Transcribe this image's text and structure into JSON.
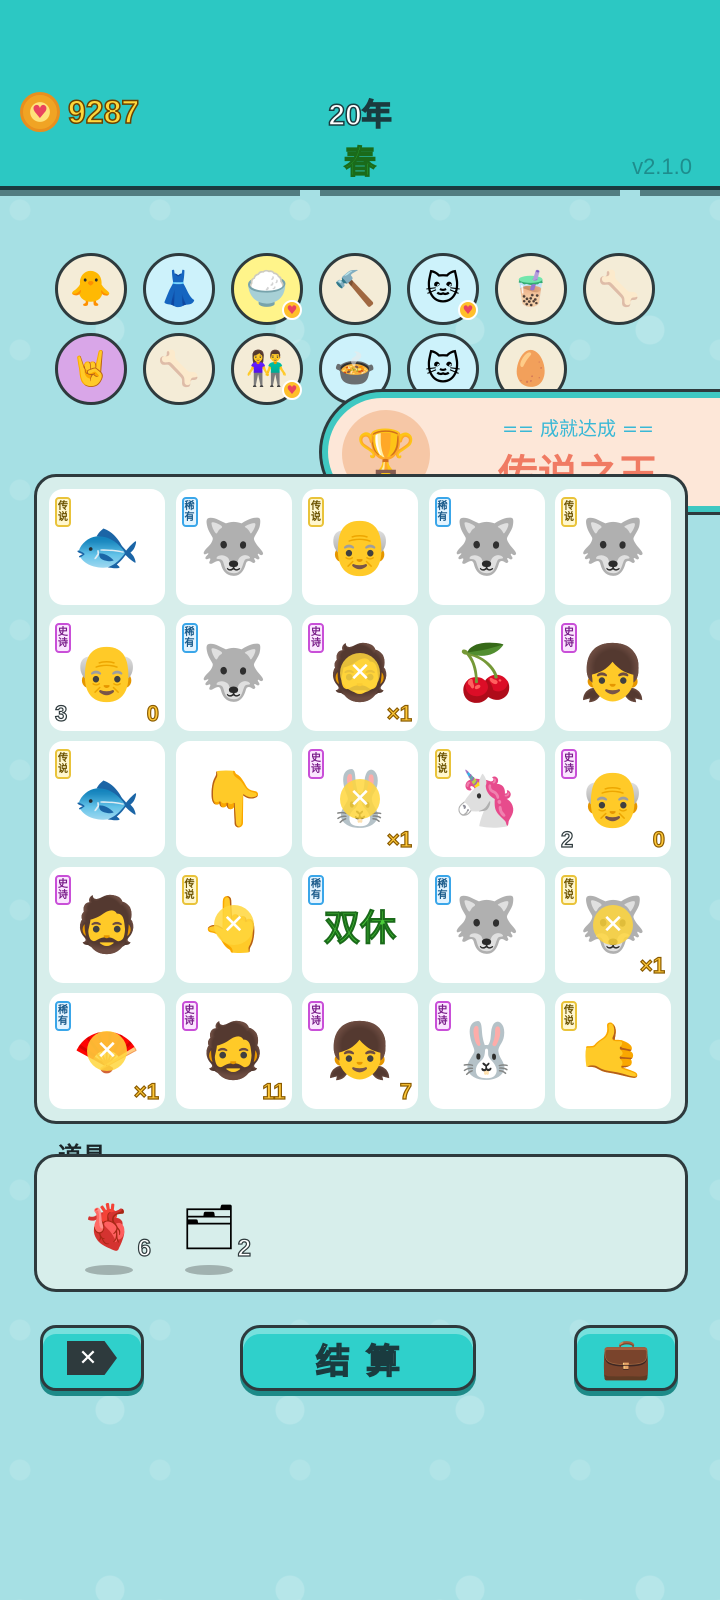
{
  "header": {
    "coins": "9287",
    "year": "20年",
    "season": "春",
    "version": "v2.1.0"
  },
  "collected": [
    {
      "icon": "chick-egg-icon",
      "glyph": "🐥"
    },
    {
      "icon": "skirt-icon",
      "glyph": "👗"
    },
    {
      "icon": "rice-bowl-icon",
      "glyph": "🍚"
    },
    {
      "icon": "hammer-icon",
      "glyph": "🔨"
    },
    {
      "icon": "cat-food-icon",
      "glyph": "🐱"
    },
    {
      "icon": "bubble-tea-icon",
      "glyph": "🧋"
    },
    {
      "icon": "dog-bowl-icon",
      "glyph": "🦴"
    },
    {
      "icon": "rock-hand-icon",
      "glyph": "🤘"
    },
    {
      "icon": "dog-bowl-icon",
      "glyph": "🦴"
    },
    {
      "icon": "couple-icon",
      "glyph": "👫"
    },
    {
      "icon": "cooking-pot-icon",
      "glyph": "🍲"
    },
    {
      "icon": "cat-food-icon",
      "glyph": "🐱"
    },
    {
      "icon": "egg-tray-icon",
      "glyph": "🥚"
    }
  ],
  "achievement": {
    "subtitle": "== 成就达成 ==",
    "title": "传说之王",
    "icon": "trophy-icon"
  },
  "rarity_labels": {
    "legend": "传说",
    "rare": "稀有",
    "epic": "史诗"
  },
  "board": [
    {
      "icon": "koi-fish-icon",
      "glyph": "🐟",
      "rarity": "legend"
    },
    {
      "icon": "husky-icon",
      "glyph": "🐺",
      "rarity": "rare"
    },
    {
      "icon": "grandpa-glasses-icon",
      "glyph": "👴",
      "rarity": "legend"
    },
    {
      "icon": "husky-icon",
      "glyph": "🐺",
      "rarity": "rare"
    },
    {
      "icon": "husky-crown-icon",
      "glyph": "🐺",
      "rarity": "legend"
    },
    {
      "icon": "old-man-icon",
      "glyph": "👴",
      "rarity": "epic",
      "left": "3",
      "right": "0"
    },
    {
      "icon": "husky-icon",
      "glyph": "🐺",
      "rarity": "rare"
    },
    {
      "icon": "green-hair-man-icon",
      "glyph": "🧔",
      "rarity": "epic",
      "right": "×1",
      "crossed": true
    },
    {
      "icon": "cherry-icon",
      "glyph": "🍒"
    },
    {
      "icon": "girl-hearts-icon",
      "glyph": "👧",
      "rarity": "epic"
    },
    {
      "icon": "koi-fish-icon",
      "glyph": "🐟",
      "rarity": "legend"
    },
    {
      "icon": "pointing-hand-icon",
      "glyph": "👇"
    },
    {
      "icon": "rabbit-tent-icon",
      "glyph": "🐰",
      "rarity": "epic",
      "right": "×1",
      "crossed": true
    },
    {
      "icon": "unicorn-icon",
      "glyph": "🦄",
      "rarity": "legend"
    },
    {
      "icon": "old-man-icon",
      "glyph": "👴",
      "rarity": "epic",
      "left": "2",
      "right": "0"
    },
    {
      "icon": "green-hair-man-icon",
      "glyph": "🧔",
      "rarity": "epic"
    },
    {
      "icon": "yellow-hand-icon",
      "glyph": "👆",
      "rarity": "legend",
      "crossed": true
    },
    {
      "icon": "double-rest-text",
      "text": "双休",
      "rarity": "rare"
    },
    {
      "icon": "husky-icon",
      "glyph": "🐺",
      "rarity": "rare"
    },
    {
      "icon": "husky-crown-icon",
      "glyph": "🐺",
      "rarity": "legend",
      "right": "×1",
      "crossed": true
    },
    {
      "icon": "folding-fan-icon",
      "glyph": "🪭",
      "rarity": "rare",
      "right": "×1",
      "crossed": true
    },
    {
      "icon": "green-hair-man-icon",
      "glyph": "🧔",
      "rarity": "epic",
      "right": "11"
    },
    {
      "icon": "girl-hearts-icon",
      "glyph": "👧",
      "rarity": "epic",
      "right": "7"
    },
    {
      "icon": "rabbit-tent-icon",
      "glyph": "🐰",
      "rarity": "epic"
    },
    {
      "icon": "yellow-hand-icon",
      "glyph": "🤙",
      "rarity": "legend"
    }
  ],
  "items": {
    "title": "道具",
    "list": [
      {
        "icon": "liver-icon",
        "glyph": "🫀",
        "count": "6"
      },
      {
        "icon": "triple-slot-icon",
        "glyph": "🗂",
        "count": "2"
      }
    ]
  },
  "buttons": {
    "exit_icon": "exit-icon",
    "settle": "结算",
    "bag_icon": "briefcase-icon"
  }
}
